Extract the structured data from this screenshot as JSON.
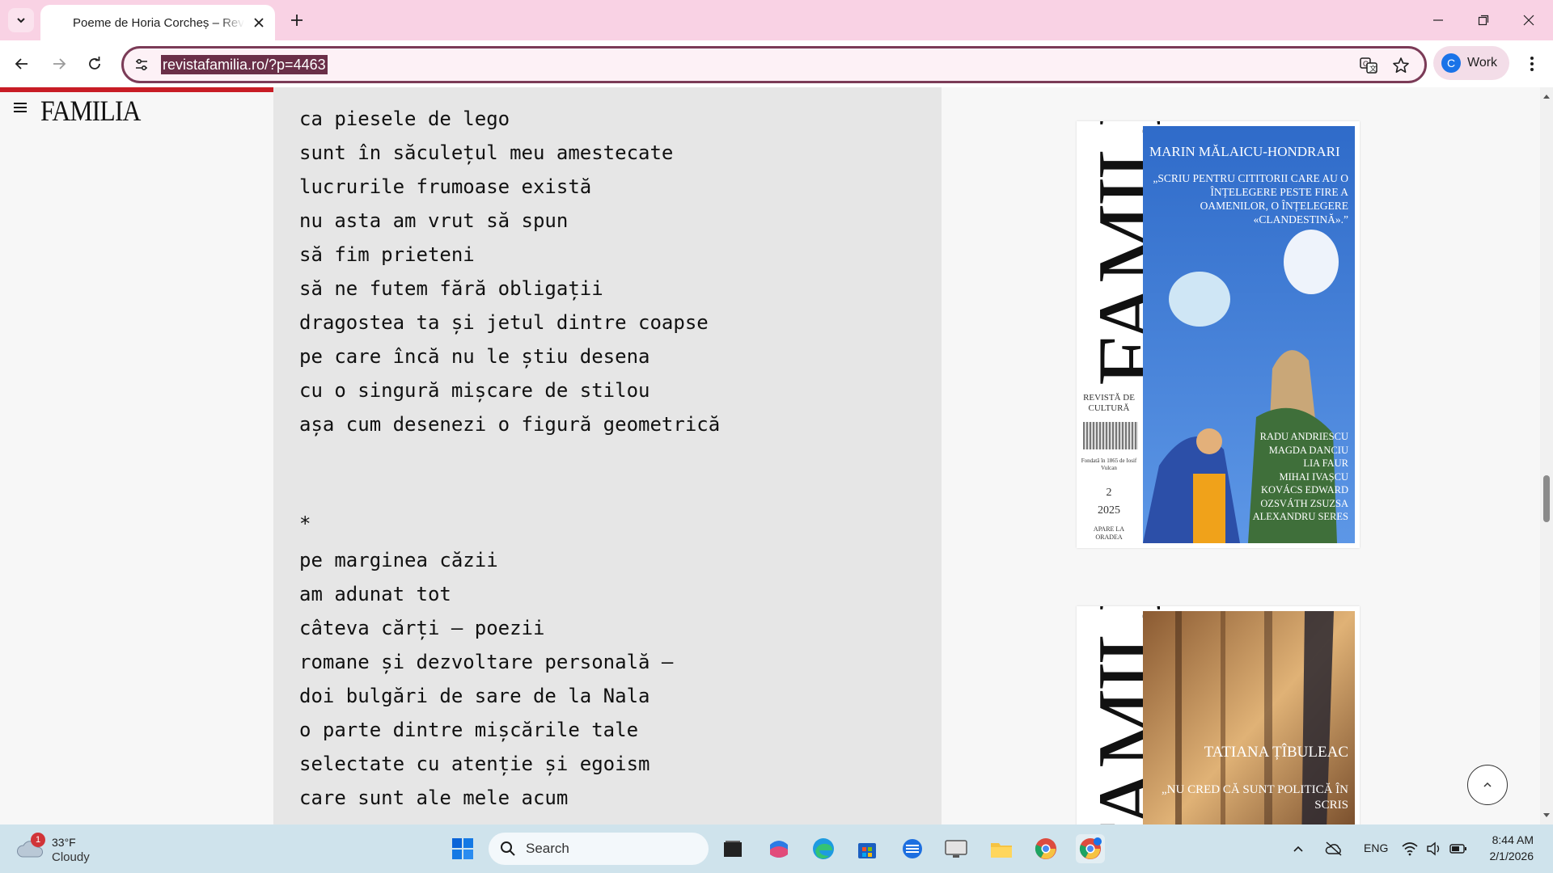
{
  "browser": {
    "tab_title": "Poeme de Horia Corcheș – Revista Familia",
    "url": "revistafamilia.ro/?p=4463",
    "profile_label": "Work",
    "profile_initial": "C"
  },
  "site": {
    "logo": "FAMILIA",
    "read_progress": 0.5
  },
  "poem": {
    "lines": [
      "ca piesele de lego",
      "sunt în săculețul meu amestecate",
      "lucrurile frumoase există",
      "nu asta am vrut să spun",
      "să fim prieteni",
      "să ne futem fără obligații",
      "dragostea ta și jetul dintre coapse",
      "pe care încă nu le știu desena",
      "cu o singură mișcare de stilou",
      "așa cum desenezi o figură geometrică",
      "*",
      "pe marginea căzii",
      "am adunat tot",
      "câteva cărți – poezii",
      "romane și dezvoltare personală –",
      "doi bulgări de sare de la Nala",
      "o parte dintre mișcările tale",
      "selectate cu atenție și egoism",
      "care sunt ale mele acum"
    ]
  },
  "covers": [
    {
      "masthead": "FAMILIA",
      "spine_caption": "REVISTĂ DE CULTURĂ",
      "founded": "Fondată în 1865 de Iosif Vulcan",
      "issue_number": "2",
      "year": "2025",
      "location": "APARE LA ORADEA",
      "headline_author": "MARIN MĂLAICU-HONDRARI",
      "headline_quote": "„SCRIU PENTRU CITITORII CARE AU O ÎNȚELEGERE PESTE FIRE A OAMENILOR, O ÎNȚELEGERE «CLANDESTINĂ».”",
      "contributors": [
        "RADU ANDRIESCU",
        "MAGDA DANCIU",
        "LIA FAUR",
        "MIHAI IVAȘCU",
        "KOVÁCS EDWARD",
        "OZSVÁTH ZSUZSA",
        "ALEXANDRU SERES"
      ]
    },
    {
      "masthead": "FAMILIA",
      "headline_author": "TATIANA ȚÎBULEAC",
      "headline_quote": "„NU CRED CĂ SUNT POLITICĂ ÎN SCRIS"
    }
  ],
  "taskbar": {
    "weather_temp": "33°F",
    "weather_condition": "Cloudy",
    "weather_badge": "1",
    "search_label": "Search",
    "language": "ENG",
    "time": "8:44 AM",
    "date": "2/1/2026"
  },
  "colors": {
    "tabstrip": "#f9d2e4",
    "omnibox_border": "#7b3b57",
    "url_highlight": "#6a2f48",
    "progress_bar": "#c81d25",
    "article_bg": "#e6e6e6",
    "taskbar": "#cfe3ec"
  }
}
